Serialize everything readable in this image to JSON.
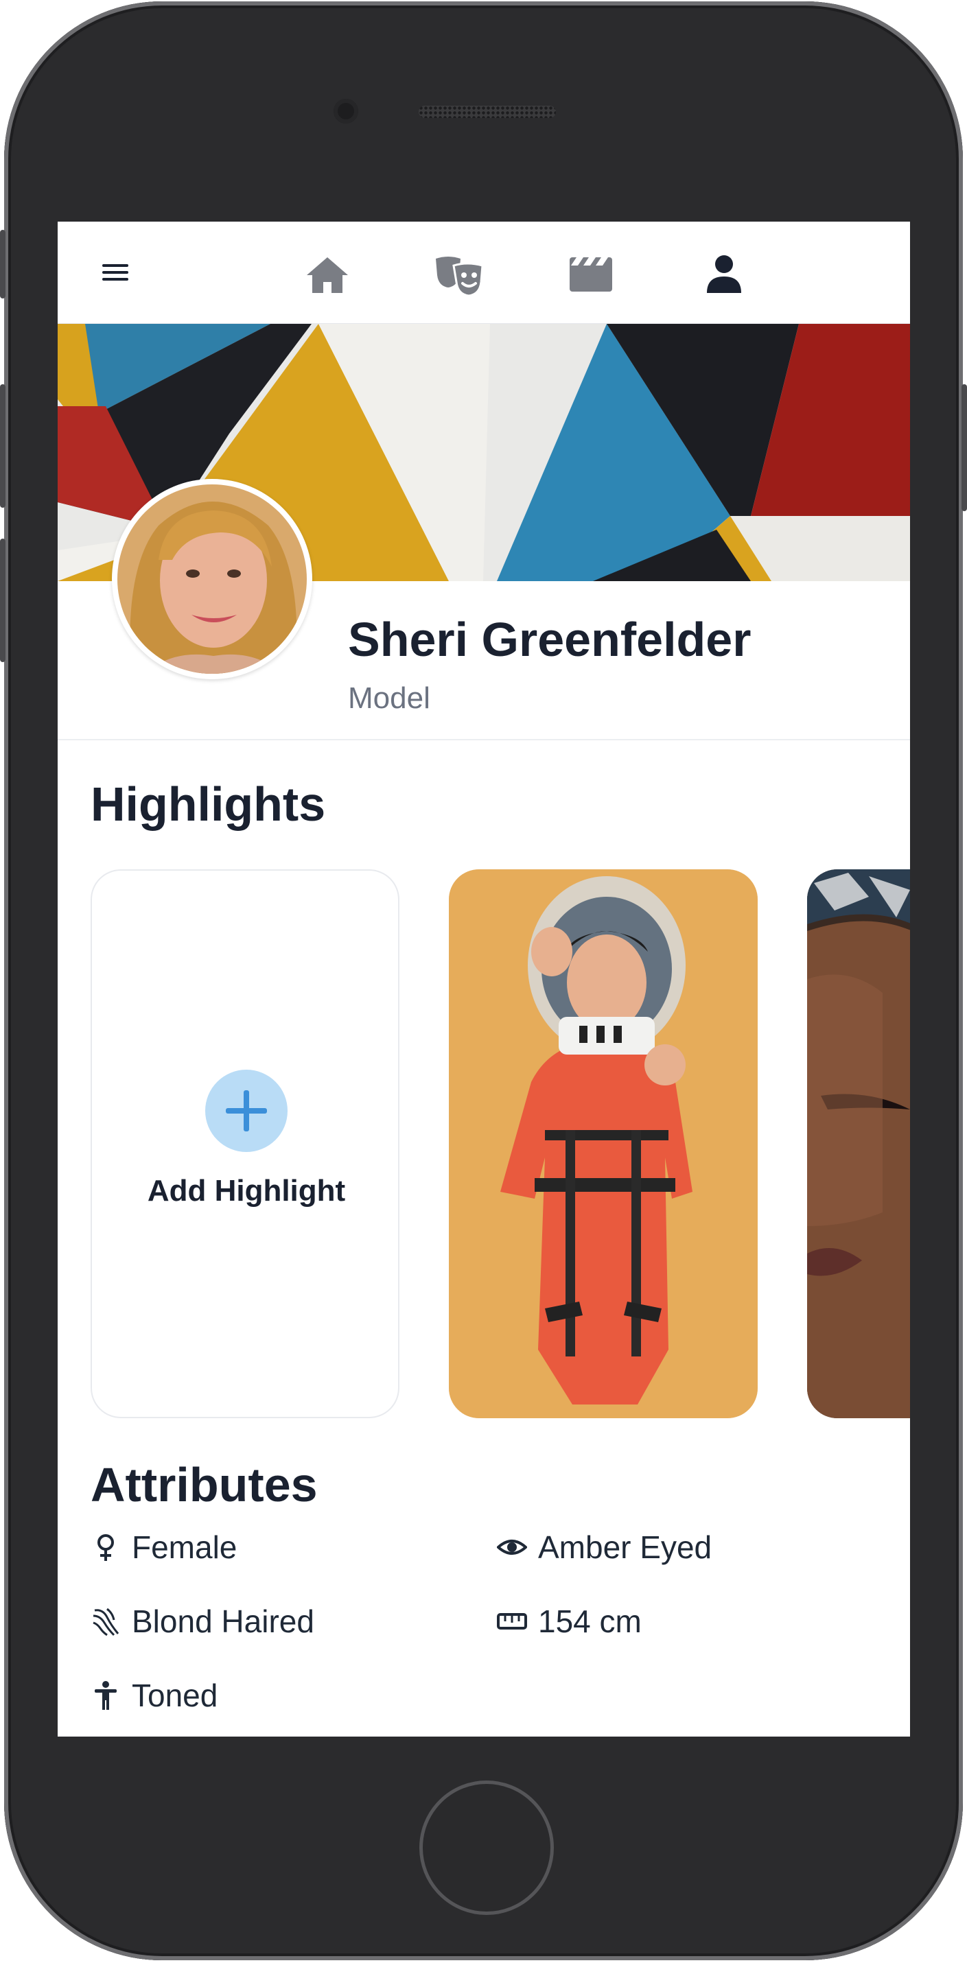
{
  "nav": {
    "icons": [
      "menu-icon",
      "home-icon",
      "theater-masks-icon",
      "clapperboard-icon",
      "user-icon"
    ]
  },
  "profile": {
    "name": "Sheri Greenfelder",
    "role": "Model"
  },
  "highlights": {
    "title": "Highlights",
    "add_label": "Add Highlight"
  },
  "attributes": {
    "title": "Attributes",
    "items": [
      {
        "icon": "venus-icon",
        "label": "Female"
      },
      {
        "icon": "eye-icon",
        "label": "Amber Eyed"
      },
      {
        "icon": "hair-icon",
        "label": "Blond Haired"
      },
      {
        "icon": "ruler-icon",
        "label": "154 cm"
      },
      {
        "icon": "person-icon",
        "label": "Toned"
      }
    ]
  },
  "colors": {
    "text_dark": "#1a2130",
    "text_muted": "#6b7280",
    "accent_blue": "#3b8fd9",
    "accent_light": "#b9dcf6"
  }
}
